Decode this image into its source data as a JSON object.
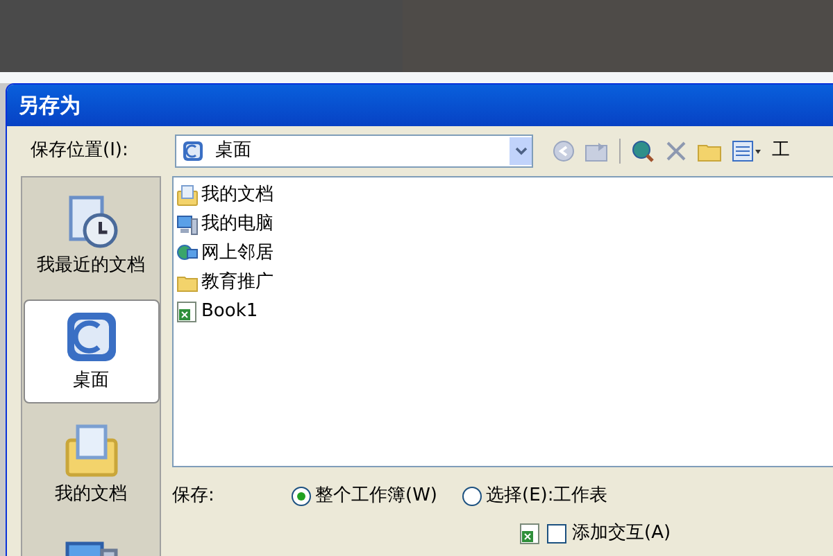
{
  "window": {
    "title": "另存为"
  },
  "save_in": {
    "label": "保存位置(I):",
    "value": "桌面",
    "toolbar_cut_label": "工"
  },
  "places": [
    {
      "label": "我最近的文档",
      "kind": "recent",
      "selected": false
    },
    {
      "label": "桌面",
      "kind": "desktop",
      "selected": true
    },
    {
      "label": "我的文档",
      "kind": "documents",
      "selected": false
    },
    {
      "kind": "computer",
      "selected": false
    }
  ],
  "files": [
    {
      "name": "我的文档",
      "kind": "documents"
    },
    {
      "name": "我的电脑",
      "kind": "computer"
    },
    {
      "name": "网上邻居",
      "kind": "network"
    },
    {
      "name": "教育推广",
      "kind": "folder"
    },
    {
      "name": "Book1",
      "kind": "excel"
    }
  ],
  "save": {
    "label": "保存:",
    "options": [
      {
        "label": "整个工作簿(W)",
        "selected": true
      },
      {
        "label": "选择(E):工作表",
        "selected": false
      }
    ],
    "interactive": {
      "label": "添加交互(A)",
      "checked": false
    }
  }
}
